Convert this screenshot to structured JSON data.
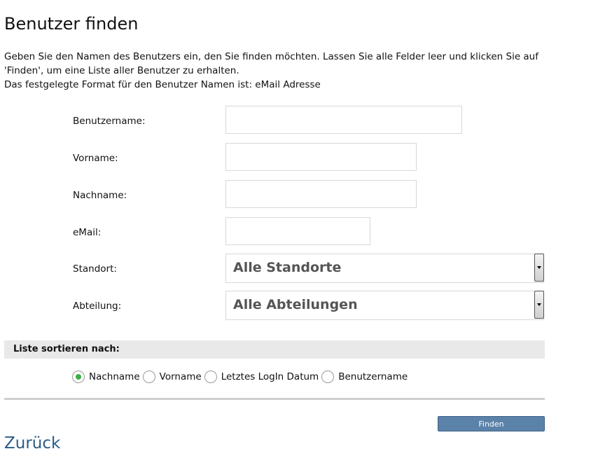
{
  "page": {
    "title": "Benutzer finden",
    "intro_line1": "Geben Sie den Namen des Benutzers ein, den Sie finden möchten. Lassen Sie alle Felder leer und klicken Sie auf",
    "intro_line2": "'Finden', um eine Liste aller Benutzer zu erhalten.",
    "intro_line3": "Das festgelegte Format für den Benutzer Namen ist: eMail Adresse"
  },
  "form": {
    "username_label": "Benutzername:",
    "username_value": "",
    "firstname_label": "Vorname:",
    "firstname_value": "",
    "lastname_label": "Nachname:",
    "lastname_value": "",
    "email_label": "eMail:",
    "email_value": "",
    "location_label": "Standort:",
    "location_selected": "Alle Standorte",
    "department_label": "Abteilung:",
    "department_selected": "Alle Abteilungen"
  },
  "sort": {
    "heading": "Liste sortieren nach:",
    "options": [
      {
        "label": "Nachname",
        "checked": true
      },
      {
        "label": "Vorname",
        "checked": false
      },
      {
        "label": "Letztes LogIn Datum",
        "checked": false
      },
      {
        "label": "Benutzername",
        "checked": false
      }
    ]
  },
  "actions": {
    "find_label": "Finden",
    "back_label": "Zurück"
  },
  "colors": {
    "button": "#5b82a8",
    "link": "#2a5c88",
    "radio_checked": "#3cb043"
  }
}
